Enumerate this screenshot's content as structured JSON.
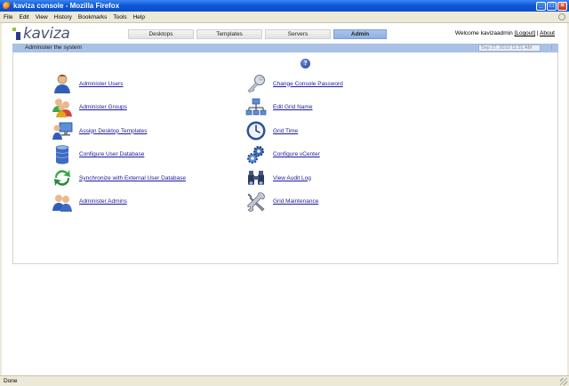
{
  "window": {
    "title": "kaviza console - Mozilla Firefox",
    "minimize": "_",
    "maximize": "□",
    "close": "×"
  },
  "menubar": {
    "items": [
      "File",
      "Edit",
      "View",
      "History",
      "Bookmarks",
      "Tools",
      "Help"
    ]
  },
  "app": {
    "logo_text": "kaviza",
    "tabs": [
      {
        "label": "Desktops",
        "active": false
      },
      {
        "label": "Templates",
        "active": false
      },
      {
        "label": "Servers",
        "active": false
      },
      {
        "label": "Admin",
        "active": true
      }
    ],
    "welcome_prefix": "Welcome kavizaadmin",
    "logout_label": "[Logout]",
    "separator": "|",
    "about_label": "About",
    "section_title": "Administer the system",
    "date_text": "Sep 27, 2010 11:31 AM",
    "date_button": "⋮",
    "help_symbol": "?"
  },
  "actions_left": [
    {
      "label": "Administer Users",
      "icon": "user-icon"
    },
    {
      "label": "Administer Groups",
      "icon": "group-icon"
    },
    {
      "label": "Assign Desktop Templates",
      "icon": "desktop-assign-icon"
    },
    {
      "label": "Configure User Database",
      "icon": "database-icon"
    },
    {
      "label": "Synchronize with External User Database",
      "icon": "sync-icon"
    },
    {
      "label": "Administer Admins",
      "icon": "admins-icon"
    }
  ],
  "actions_right": [
    {
      "label": "Change Console Password",
      "icon": "key-icon"
    },
    {
      "label": "Edit Grid Name",
      "icon": "network-icon"
    },
    {
      "label": "Grid Time",
      "icon": "clock-icon"
    },
    {
      "label": "Configure vCenter",
      "icon": "gears-icon"
    },
    {
      "label": "View Audit Log",
      "icon": "binoculars-icon"
    },
    {
      "label": "Grid Maintenance",
      "icon": "tools-icon"
    }
  ],
  "status": {
    "text": "Done"
  }
}
